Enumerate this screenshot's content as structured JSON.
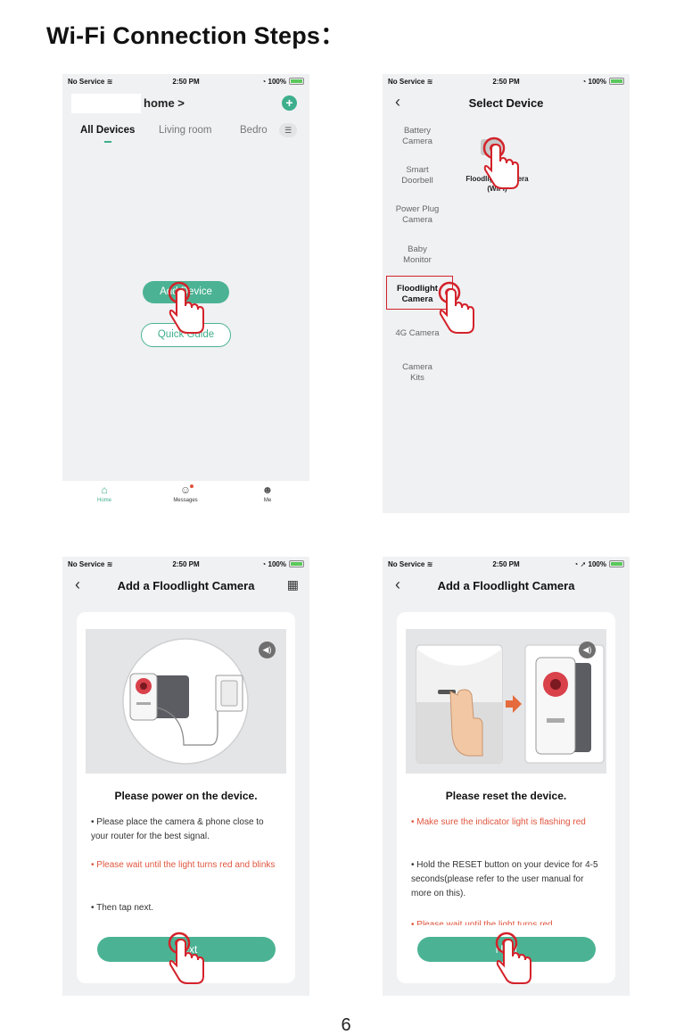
{
  "title": "Wi-Fi Connection Steps",
  "title_suffix": "：",
  "status": {
    "carrier": "No Service",
    "time": "2:50 PM",
    "battery": "100%"
  },
  "screen1": {
    "home_title": "home >",
    "tabs": [
      "All Devices",
      "Living room",
      "Bedro"
    ],
    "add_device": "Add Device",
    "quick_guide": "Quick Guide",
    "tabbar": [
      "Home",
      "Messages",
      "Me"
    ]
  },
  "screen2": {
    "title": "Select Device",
    "categories": [
      "Battery\nCamera",
      "Smart\nDoorbell",
      "Power Plug\nCamera",
      "Baby\nMonitor",
      "Floodlight\nCamera",
      "4G Camera",
      "Camera\nKits"
    ],
    "product_label": "Floodlight Camera\n(WIFI)"
  },
  "screen3": {
    "title": "Add a Floodlight Camera",
    "heading": "Please power on the device.",
    "p1": "• Please place the camera & phone close to your router for the best signal.",
    "p2": "• Please wait until the light turns red and blinks",
    "p3": "• Then tap next.",
    "next": "Next"
  },
  "screen4": {
    "title": "Add a Floodlight Camera",
    "heading": "Please reset the device.",
    "p1": "• Make sure the indicator light is flashing red",
    "p2": "• Hold the RESET button on your device for 4-5 seconds(please refer to the user manual for more on this).",
    "p3": "• Please wait until the light turns red",
    "next": "Next"
  },
  "page_number": "6"
}
